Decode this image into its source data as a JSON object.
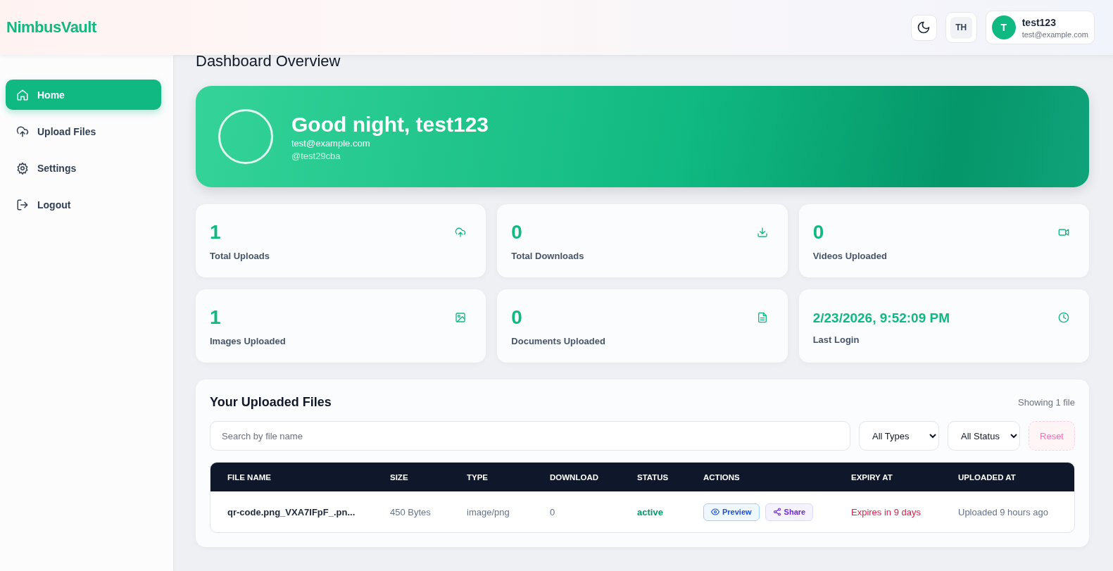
{
  "brand": "NimbusVault",
  "header": {
    "language": "TH",
    "user": {
      "initial": "T",
      "name": "test123",
      "email": "test@example.com"
    }
  },
  "sidebar": {
    "items": [
      {
        "label": "Home",
        "kind": "home",
        "selected": true
      },
      {
        "label": "Upload Files",
        "kind": "upload",
        "selected": false
      },
      {
        "label": "Settings",
        "kind": "settings",
        "selected": false
      },
      {
        "label": "Logout",
        "kind": "logout",
        "selected": false
      }
    ]
  },
  "page_title": "Dashboard Overview",
  "hero": {
    "greeting": "Good night, test123",
    "email": "test@example.com",
    "handle": "@test29cba"
  },
  "stats": [
    {
      "value": "1",
      "label": "Total Uploads",
      "kind": "upload"
    },
    {
      "value": "0",
      "label": "Total Downloads",
      "kind": "download"
    },
    {
      "value": "0",
      "label": "Videos Uploaded",
      "kind": "video"
    },
    {
      "value": "1",
      "label": "Images Uploaded",
      "kind": "image"
    },
    {
      "value": "0",
      "label": "Documents Uploaded",
      "kind": "document"
    },
    {
      "value": "2/23/2026, 9:52:09 PM",
      "label": "Last Login",
      "kind": "login"
    }
  ],
  "files": {
    "title": "Your Uploaded Files",
    "count": "Showing 1 file",
    "search": {
      "placeholder": "Search by file name"
    },
    "filters": [
      "All Types",
      "All Status"
    ],
    "reset": "Reset",
    "columns": [
      "FILE NAME",
      "SIZE",
      "TYPE",
      "DOWNLOAD",
      "STATUS",
      "ACTIONS",
      "EXPIRY AT",
      "UPLOADED AT"
    ],
    "rows": [
      {
        "name": "qr-code.png_VXA7IFpF_.pn...",
        "size": "450 Bytes",
        "type": "image/png",
        "downloads": "0",
        "status": "active",
        "actions": [
          "Preview",
          "Share"
        ],
        "expiry": "Expires in 9 days",
        "uploaded": "Uploaded 9 hours ago"
      }
    ]
  }
}
